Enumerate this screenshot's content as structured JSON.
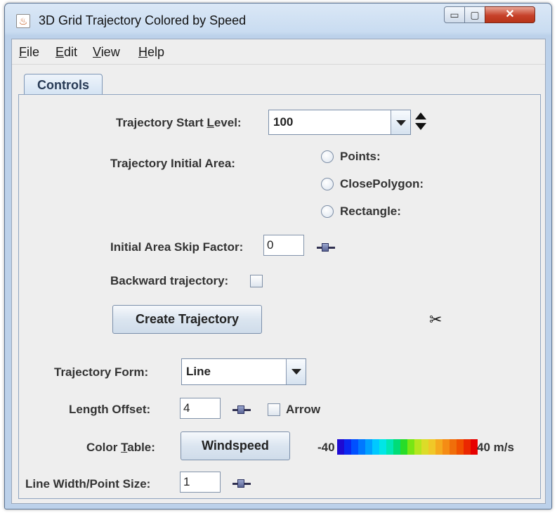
{
  "window": {
    "title": "3D Grid Trajectory Colored by Speed",
    "icon": "java-cup-icon",
    "controls": {
      "minimize": "▭",
      "maximize": "▢",
      "close": "✕"
    }
  },
  "menu": {
    "file": {
      "mnemonic": "F",
      "rest": "ile"
    },
    "edit": {
      "mnemonic": "E",
      "rest": "dit"
    },
    "view": {
      "mnemonic": "V",
      "rest": "iew"
    },
    "help": {
      "mnemonic": "H",
      "rest": "elp"
    }
  },
  "tabs": [
    {
      "label": "Controls",
      "selected": true
    }
  ],
  "controls": {
    "start_level": {
      "label_pre": "Trajectory Start ",
      "label_mnemonic": "L",
      "label_post": "evel:",
      "value": "100"
    },
    "initial_area": {
      "label": "Trajectory Initial Area:",
      "options": [
        "Points:",
        "ClosePolygon:",
        "Rectangle:"
      ]
    },
    "skip_factor": {
      "label": "Initial Area Skip Factor:",
      "value": "0"
    },
    "backward": {
      "label": "Backward trajectory:",
      "checked": false
    },
    "create_button": "Create Trajectory",
    "form": {
      "label": "Trajectory Form:",
      "value": "Line"
    },
    "length_offset": {
      "label": "Length Offset:",
      "value": "4"
    },
    "arrow": {
      "label": "Arrow",
      "checked": false
    },
    "color_table": {
      "label_pre": "Color ",
      "label_mnemonic": "T",
      "label_post": "able:",
      "button": "Windspeed",
      "min_label": "-40",
      "max_label": "40 m/s",
      "colors": [
        "#1e0ad2",
        "#0a28f0",
        "#0050ff",
        "#0078ff",
        "#00a0ff",
        "#00c8ff",
        "#00e6e6",
        "#00e6b4",
        "#00dc78",
        "#28dc28",
        "#78e614",
        "#b4e61e",
        "#dcdc28",
        "#f0c828",
        "#f5aa1e",
        "#f58c14",
        "#f06e0a",
        "#f05000",
        "#eb2800",
        "#e60000"
      ]
    },
    "line_width": {
      "label": "Line Width/Point Size:",
      "value": "1"
    }
  }
}
